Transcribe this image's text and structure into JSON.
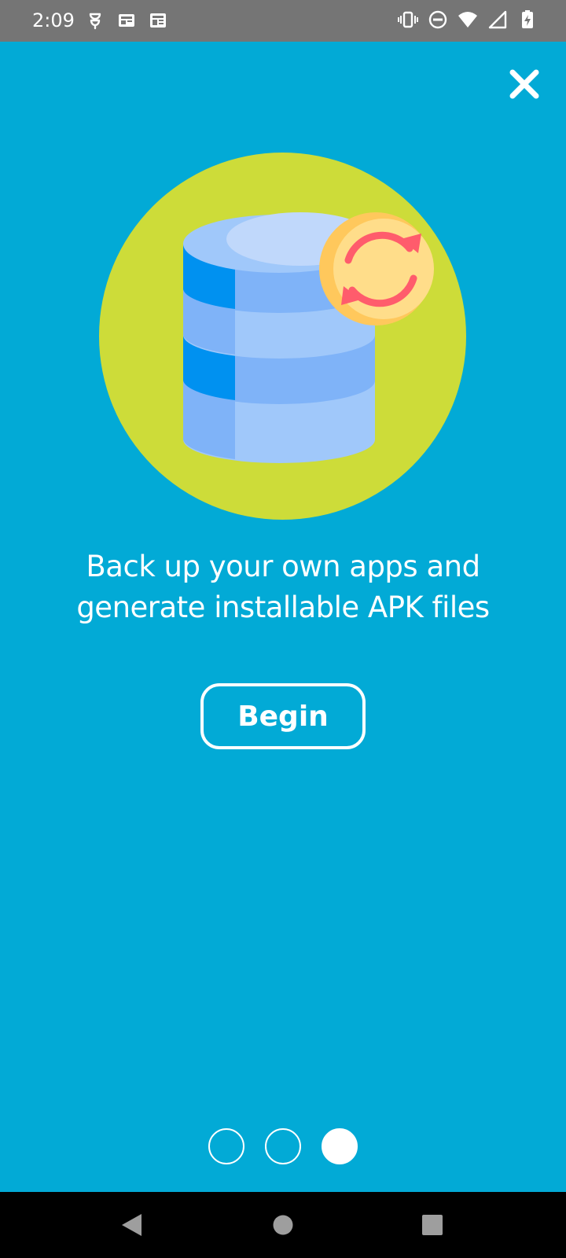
{
  "status_bar": {
    "time": "2:09",
    "left_icons": [
      "privacy-icon",
      "news-icon",
      "news-alt-icon"
    ],
    "right_icons": [
      "vibrate-icon",
      "do-not-disturb-icon",
      "wifi-icon",
      "cellular-signal-icon",
      "battery-charging-icon"
    ]
  },
  "onboarding": {
    "close_icon": "close-icon",
    "illustration": "database-sync-illustration",
    "message_line1": "Back up your own apps and",
    "message_line2": "generate installable APK files",
    "begin_label": "Begin",
    "page_count": 3,
    "current_page": 3
  },
  "nav_bar": {
    "back_icon": "back-triangle-icon",
    "home_icon": "home-circle-icon",
    "recents_icon": "recents-square-icon"
  },
  "colors": {
    "background": "#02aad6",
    "circle": "#cddc39",
    "db_dark": "#0091f0",
    "db_mid": "#7fb3f8",
    "db_light": "#a0c8fa",
    "badge": "#ffd98a",
    "arrows": "#ff5c6c"
  }
}
